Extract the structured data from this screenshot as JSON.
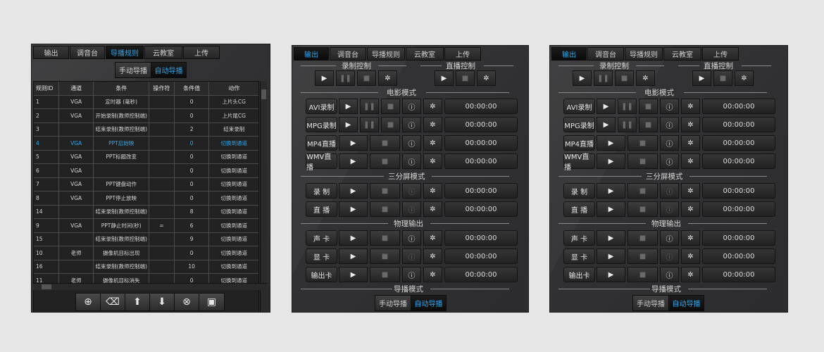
{
  "tabs": [
    "输出",
    "调音台",
    "导播规则",
    "云教室",
    "上传"
  ],
  "left": {
    "active_tab": 2,
    "mode_buttons": [
      "手动导播",
      "自动导播"
    ],
    "columns": [
      "规则ID",
      "通道",
      "条件",
      "操作符",
      "条件值",
      "动作"
    ],
    "rows": [
      [
        "1",
        "VGA",
        "定时器 (毫秒)",
        "",
        "0",
        "上片头CG"
      ],
      [
        "2",
        "VGA",
        "开始录制(教师控制端)",
        "",
        "0",
        "上片尾CG"
      ],
      [
        "3",
        "",
        "结束录制(教师控制端)",
        "",
        "2",
        "结束录制"
      ],
      [
        "4",
        "VGA",
        "PPT启始映",
        "",
        "0",
        "切换到通道"
      ],
      [
        "5",
        "VGA",
        "PPT标题改变",
        "",
        "0",
        "切换到通道"
      ],
      [
        "6",
        "VGA",
        "",
        "",
        "0",
        "切换到通道"
      ],
      [
        "7",
        "VGA",
        "PPT键盘动作",
        "",
        "0",
        "切换到通道"
      ],
      [
        "8",
        "VGA",
        "PPT停止放映",
        "",
        "0",
        "切换到通道"
      ],
      [
        "14",
        "",
        "结束录制(教师控制端)",
        "",
        "8",
        "切换到通道"
      ],
      [
        "9",
        "VGA",
        "PPT静止时间(秒)",
        "=",
        "6",
        "切换到通道"
      ],
      [
        "15",
        "",
        "结束录制(教师控制端)",
        "",
        "9",
        "切换到通道"
      ],
      [
        "10",
        "老师",
        "摄像机目标出现",
        "",
        "0",
        "切换到通道"
      ],
      [
        "16",
        "",
        "结束录制(教师控制端)",
        "",
        "10",
        "切换到通道"
      ],
      [
        "11",
        "老师",
        "摄像机目标消失",
        "",
        "0",
        "切换到通道"
      ]
    ],
    "toolbar": [
      "plus-circle-icon",
      "eraser-icon",
      "arrow-up-icon",
      "arrow-down-icon",
      "close-circle-icon",
      "save-icon"
    ]
  },
  "right": {
    "active_tab": 0,
    "sections": {
      "record_control": "录制控制",
      "live_control": "直播控制",
      "movie_mode": "电影模式",
      "triple_mode": "三分屏模式",
      "physical_out": "物理输出",
      "director_mode": "导播模式"
    },
    "movie_rows": [
      "AVI录制",
      "MPG录制",
      "MP4直播",
      "WMV直播"
    ],
    "triple_rows": [
      "录 制",
      "直 播"
    ],
    "physical_rows": [
      "声 卡",
      "显 卡",
      "输出卡"
    ],
    "timer": "00:00:00",
    "mode_buttons": [
      "手动导播",
      "自动导播"
    ]
  }
}
